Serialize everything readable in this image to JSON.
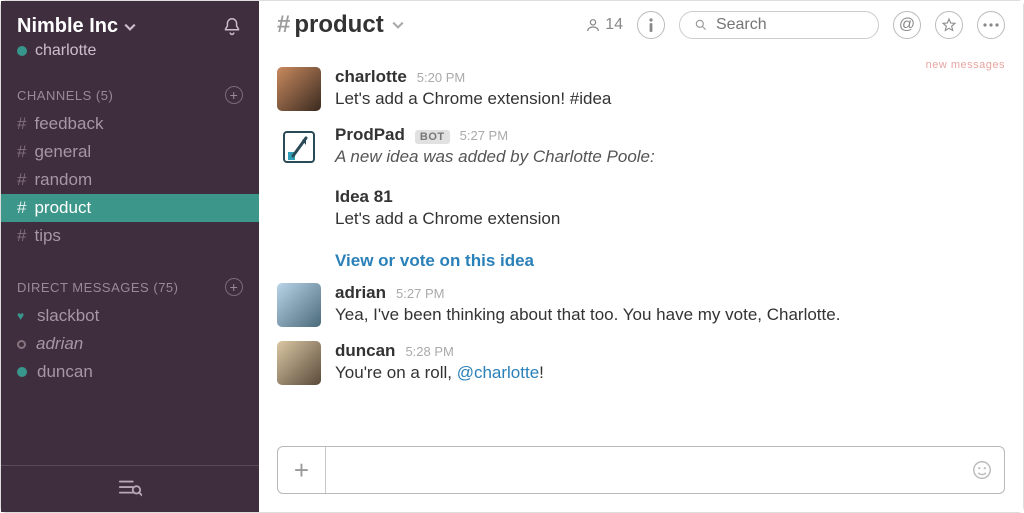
{
  "workspace": {
    "name": "Nimble Inc",
    "user": "charlotte"
  },
  "sidebar": {
    "channels_label": "CHANNELS",
    "channels_count": "(5)",
    "channels": [
      {
        "name": "feedback",
        "active": false
      },
      {
        "name": "general",
        "active": false
      },
      {
        "name": "random",
        "active": false
      },
      {
        "name": "product",
        "active": true
      },
      {
        "name": "tips",
        "active": false
      }
    ],
    "dm_label": "DIRECT MESSAGES",
    "dm_count": "(75)",
    "dms": [
      {
        "name": "slackbot",
        "presence": "heart",
        "italic": false
      },
      {
        "name": "adrian",
        "presence": "away",
        "italic": true
      },
      {
        "name": "duncan",
        "presence": "online",
        "italic": false
      }
    ]
  },
  "header": {
    "channel": "product",
    "members": "14",
    "search_placeholder": "Search",
    "new_messages_label": "new messages"
  },
  "messages": [
    {
      "user": "charlotte",
      "time": "5:20 PM",
      "text": "Let's add a Chrome extension! #idea",
      "avatar": "av-charlotte"
    },
    {
      "user": "ProdPad",
      "bot": "BOT",
      "time": "5:27 PM",
      "italic_text": "A new idea was added by Charlotte Poole:",
      "avatar": "av-prodpad",
      "idea": {
        "title": "Idea 81",
        "text": "Let's add a Chrome extension",
        "link": "View or vote on this idea"
      }
    },
    {
      "user": "adrian",
      "time": "5:27 PM",
      "text": "Yea, I've been thinking about that too. You have my vote, Charlotte.",
      "avatar": "av-adrian"
    },
    {
      "user": "duncan",
      "time": "5:28 PM",
      "text_pre": "You're on a roll, ",
      "mention": "@charlotte",
      "text_post": "!",
      "avatar": "av-duncan"
    }
  ],
  "composer": {
    "value": ""
  }
}
